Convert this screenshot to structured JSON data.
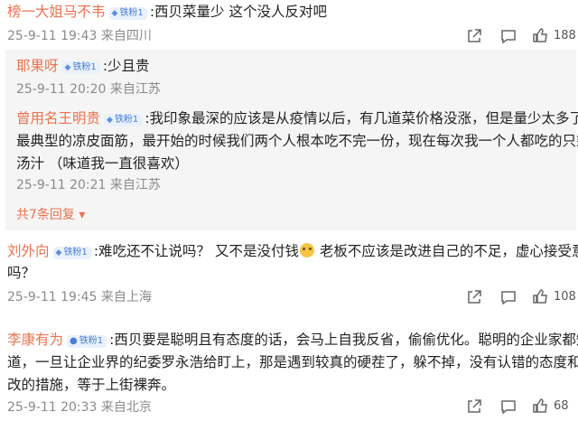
{
  "badge_label": "铁粉1",
  "comments": [
    {
      "user": "榜一大姐马不韦",
      "text": ":西贝菜量少  这个没人反对吧",
      "time": "25-9-11 19:43 来自四川",
      "likes": "188"
    },
    {
      "user": "刘外向",
      "text_part1": ":难吃还不让说吗？ 又不是没付钱",
      "text_part2": " 老板不应该是改进自己的不足，虚心接受意见",
      "text_line2": "吗？",
      "time": "25-9-11 19:45 来自上海",
      "likes": "108",
      "emoji": "sweat-smile-emoji"
    },
    {
      "user": "李康有为",
      "text_line1": ":西贝要是聪明且有态度的话，会马上自我反省，偷偷优化。聪明的企业家都知",
      "text_line2": "道，一旦让企业界的纪委罗永浩给盯上，那是遇到较真的硬茬了，躲不掉，没有认错的态度和整",
      "text_line3": "改的措施，等于上街裸奔。",
      "time": "25-9-11 20:33 来自北京",
      "likes": "68"
    }
  ],
  "replies": [
    {
      "user": "耶果呀",
      "text": ":少且贵",
      "time": "25-9-11 20:20 来自江苏"
    },
    {
      "user": "曾用名王明贵",
      "text_line1": ":我印象最深的应该是从疫情以后，有几道菜价格没涨，但是量少太多了。",
      "text_line2": "最典型的凉皮面筋，最开始的时候我们两个人根本吃不完一份，现在每次我一个人都吃的只剩",
      "text_line3": "汤汁 （味道我一直很喜欢）",
      "time": "25-9-11 20:21 来自江苏"
    }
  ],
  "expand_replies": "共7条回复 ▾",
  "icons": [
    "share-icon",
    "comment-icon",
    "like-icon"
  ],
  "colors": {
    "username": "#eb7350",
    "meta": "#8a8a8a",
    "reply_bg": "#f5f5f5",
    "badge_bg": "#e9f1fc"
  }
}
